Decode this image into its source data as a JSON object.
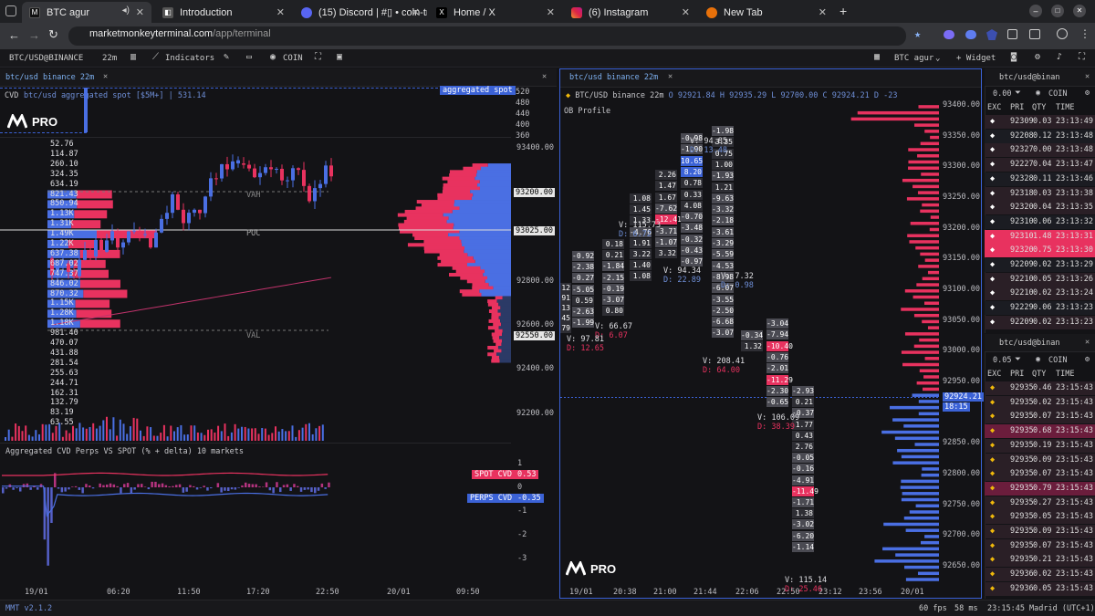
{
  "browser": {
    "tabs": [
      {
        "label": "BTC agur",
        "color": "#1a1a1a",
        "glyph": "M"
      },
      {
        "label": "Introduction",
        "color": "#444",
        "glyph": "◧"
      },
      {
        "label": "(15) Discord | #▯ • coin-tr",
        "color": "#5865f2",
        "glyph": "●"
      },
      {
        "label": "Home / X",
        "color": "#000",
        "glyph": "X"
      },
      {
        "label": "(6) Instagram",
        "color": "#d6249f",
        "glyph": "◎"
      },
      {
        "label": "New Tab",
        "color": "#e8710a",
        "glyph": "●"
      }
    ],
    "url_host": "marketmonkeyterminal.com",
    "url_path": "/app/terminal"
  },
  "toolbar": {
    "symbol": "BTC/USD@BINANCE",
    "timeframe": "22m",
    "indicators": "Indicators",
    "coin": "COIN",
    "layout": "BTC agur",
    "widget": "+ Widget"
  },
  "left_panel": {
    "tab": "btc/usd binance 22m",
    "cvd_title": "CVD",
    "cvd_sub": "btc/usd aggregated spot [$5M+] | 531.14",
    "agg_badge": "aggregated spot",
    "cvd_axis": [
      "520",
      "480",
      "440",
      "400",
      "360"
    ],
    "brand": "PRO",
    "vp_labels": [
      "52.76",
      "114.87",
      "260.10",
      "324.35",
      "634.19",
      "821.43",
      "850.94",
      "1.13K",
      "1.31K",
      "1.49K",
      "1.22K",
      "637.38",
      "687.02",
      "747.37",
      "846.02",
      "870.32",
      "1.15K",
      "1.28K",
      "1.18K",
      "981.40",
      "470.07",
      "431.88",
      "281.54",
      "255.63",
      "244.71",
      "162.31",
      "132.79",
      "83.19",
      "63.55"
    ],
    "price_axis": [
      "93400.00",
      "93200.00",
      "93025.00",
      "92800.00",
      "92600.00",
      "92550.00",
      "92400.00",
      "92200.00"
    ],
    "vah": "VAH",
    "poc": "POC",
    "val": "VAL",
    "bottom_title": "Aggregated CVD Perps VS SPOT (% + delta) 10 markets",
    "bottom_axis": [
      "1",
      "0",
      "-1",
      "-2",
      "-3"
    ],
    "spot_cvd_label": "SPOT CVD",
    "spot_cvd_val": "0.53",
    "perps_cvd_label": "PERPS CVD",
    "perps_cvd_val": "-0.35",
    "time_axis": [
      "19/01",
      "06:20",
      "11:50",
      "17:20",
      "22:50",
      "20/01",
      "09:50"
    ]
  },
  "middle_panel": {
    "tab": "btc/usd binance 22m",
    "ohlc": "BTC/USD binance 22m",
    "o": "O 92921.84",
    "h": "H 92935.29",
    "l": "L 92700.00",
    "c": "C 92924.21",
    "d": "D -23",
    "profile": "OB Profile",
    "price_axis": [
      "93400.00",
      "93350.00",
      "93300.00",
      "93250.00",
      "93200.00",
      "93150.00",
      "93100.00",
      "93050.00",
      "93000.00",
      "92950.00",
      "92924.21",
      "18:15",
      "92850.00",
      "92800.00",
      "92750.00",
      "92700.00",
      "92650.00"
    ],
    "time_axis": [
      "19/01",
      "20:38",
      "21:00",
      "21:44",
      "22:06",
      "22:50",
      "23:12",
      "23:56",
      "20/01"
    ],
    "brand": "PRO",
    "vd": [
      {
        "v": "V: 115.73",
        "d": "D: 6.72"
      },
      {
        "v": "V: 94.85",
        "d": "D: 13.48"
      },
      {
        "v": "V: 94.34",
        "d": "D: 22.89"
      },
      {
        "v": "V: 7.32",
        "d": "D: 0.98"
      },
      {
        "v": "V: 66.67",
        "d": "D: 6.07"
      },
      {
        "v": "V: 97.81",
        "d": "D: 12.65"
      },
      {
        "v": "V: 208.41",
        "d": "D: 64.00"
      },
      {
        "v": "V: 106.09",
        "d": "D: 38.39"
      },
      {
        "v": "V: 115.14",
        "d": "D: 25.46"
      }
    ],
    "cols": [
      [
        "12",
        "91",
        "13",
        "45",
        "79"
      ],
      [
        "-0.92",
        "-2.38",
        "-0.27",
        "-5.05",
        "0.59",
        "-2.63",
        "-1.99"
      ],
      [
        "0.18",
        "0.21",
        "-1.84",
        "-2.15",
        "-0.19",
        "-3.07",
        "0.80"
      ],
      [
        "1.08",
        "1.45",
        "1.33",
        "-4.76",
        "1.91",
        "3.22",
        "1.40",
        "1.08"
      ],
      [
        "2.26",
        "1.47",
        "1.67",
        "-7.62",
        "-12.41",
        "-3.71",
        "-1.07",
        "3.32"
      ],
      [
        "-0.98",
        "-1.90",
        "10.65",
        "8.20",
        "0.78",
        "0.33",
        "4.08",
        "-0.70",
        "-3.48",
        "-0.32",
        "-0.43",
        "-0.97"
      ],
      [
        "-1.98",
        "3.35",
        "0.75",
        "1.00",
        "-1.93",
        "1.21",
        "-9.63",
        "-3.32",
        "-2.18",
        "-3.61",
        "-3.29",
        "-5.59",
        "-4.53",
        "-8.98",
        "-6.07",
        "-3.55",
        "-2.50",
        "-6.68",
        "-3.07"
      ],
      [
        "-0.34",
        "1.32"
      ],
      [
        "-3.04",
        "-7.94",
        "-10.40",
        "-0.76",
        "-2.01",
        "-11.29",
        "-2.30",
        "-0.65"
      ],
      [
        "-2.93",
        "0.21",
        "-0.37",
        "1.77",
        "0.43",
        "2.76",
        "-0.05",
        "-0.16",
        "-4.91",
        "-11.49",
        "-1.71",
        "1.38",
        "-3.02",
        "-6.20",
        "-1.14"
      ]
    ]
  },
  "right_panel": {
    "top": {
      "title": "btc/usd@binan",
      "size": "0.00",
      "coin": "COIN",
      "headers": [
        "EXC",
        "PRI",
        "QTY",
        "TIME"
      ],
      "rows": [
        [
          "92309",
          "0.03",
          "23:13:49"
        ],
        [
          "92208",
          "0.12",
          "23:13:48"
        ],
        [
          "92327",
          "0.00",
          "23:13:48"
        ],
        [
          "92227",
          "0.04",
          "23:13:47"
        ],
        [
          "92328",
          "0.11",
          "23:13:46"
        ],
        [
          "92318",
          "0.03",
          "23:13:38"
        ],
        [
          "92320",
          "0.04",
          "23:13:35"
        ],
        [
          "92310",
          "0.06",
          "23:13:32"
        ],
        [
          "92310",
          "1.48",
          "23:13:31"
        ],
        [
          "92320",
          "0.75",
          "23:13:30"
        ],
        [
          "92209",
          "0.02",
          "23:13:29"
        ],
        [
          "92210",
          "0.05",
          "23:13:26"
        ],
        [
          "92210",
          "0.02",
          "23:13:24"
        ],
        [
          "92229",
          "0.06",
          "23:13:23"
        ],
        [
          "92209",
          "0.02",
          "23:13:23"
        ]
      ]
    },
    "bottom": {
      "title": "btc/usd@binan",
      "size": "0.05",
      "coin": "COIN",
      "headers": [
        "EXC",
        "PRI",
        "QTY",
        "TIME"
      ],
      "rows": [
        [
          "92935",
          "0.46",
          "23:15:43"
        ],
        [
          "92935",
          "0.02",
          "23:15:43"
        ],
        [
          "92935",
          "0.07",
          "23:15:43"
        ],
        [
          "92935",
          "0.68",
          "23:15:43"
        ],
        [
          "92935",
          "0.19",
          "23:15:43"
        ],
        [
          "92935",
          "0.09",
          "23:15:43"
        ],
        [
          "92935",
          "0.07",
          "23:15:43"
        ],
        [
          "92935",
          "0.79",
          "23:15:43"
        ],
        [
          "92935",
          "0.27",
          "23:15:43"
        ],
        [
          "92935",
          "0.05",
          "23:15:43"
        ],
        [
          "92935",
          "0.09",
          "23:15:43"
        ],
        [
          "92935",
          "0.07",
          "23:15:43"
        ],
        [
          "92935",
          "0.21",
          "23:15:43"
        ],
        [
          "92936",
          "0.02",
          "23:15:43"
        ],
        [
          "92936",
          "0.05",
          "23:15:43"
        ]
      ]
    }
  },
  "status": {
    "version": "MMT v2.1.2",
    "fps": "60 fps",
    "ms": "58 ms",
    "clock": "23:15:45 Madrid (UTC+1)"
  },
  "colors": {
    "bid": "#4a6fe3",
    "ask": "#e8325f",
    "bg": "#131316",
    "panel": "#18181b"
  }
}
